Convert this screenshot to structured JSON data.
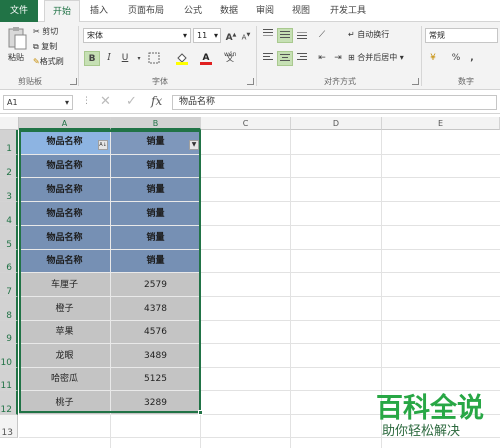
{
  "tabs": [
    "文件",
    "开始",
    "插入",
    "页面布局",
    "公式",
    "数据",
    "审阅",
    "视图",
    "开发工具"
  ],
  "ribbon": {
    "clipboard": {
      "paste": "粘贴",
      "cut": "剪切",
      "copy": "复制",
      "format_painter": "格式刷",
      "label": "剪贴板"
    },
    "font": {
      "name": "宋体",
      "size": "11",
      "bold": "B",
      "italic": "I",
      "underline": "U",
      "label": "字体",
      "grow": "A",
      "shrink": "A",
      "wen": "wén"
    },
    "alignment": {
      "wrap": "自动换行",
      "merge": "合并后居中",
      "label": "对齐方式"
    },
    "number": {
      "format": "常规",
      "percent": "%",
      "comma": ",",
      "label": "数字"
    }
  },
  "name_box": "A1",
  "fx": "fx",
  "formula_value": "物品名称",
  "columns": [
    "A",
    "B",
    "C",
    "D",
    "E"
  ],
  "rows": [
    "1",
    "2",
    "3",
    "4",
    "5",
    "6",
    "7",
    "8",
    "9",
    "10",
    "11",
    "12",
    "13"
  ],
  "header_row": {
    "a": "物品名称",
    "b": "销量"
  },
  "filter_icon_a": "A↓",
  "filter_icon_b": "▼",
  "repeat_rows": [
    {
      "a": "物品名称",
      "b": "销量"
    },
    {
      "a": "物品名称",
      "b": "销量"
    },
    {
      "a": "物品名称",
      "b": "销量"
    },
    {
      "a": "物品名称",
      "b": "销量"
    },
    {
      "a": "物品名称",
      "b": "销量"
    }
  ],
  "data_rows": [
    {
      "a": "车厘子",
      "b": "2579"
    },
    {
      "a": "橙子",
      "b": "4378"
    },
    {
      "a": "苹果",
      "b": "4576"
    },
    {
      "a": "龙眼",
      "b": "3489"
    },
    {
      "a": "哈密瓜",
      "b": "5125"
    },
    {
      "a": "桃子",
      "b": "3289"
    }
  ],
  "watermark": {
    "line1": "百科全说",
    "line2": "助你轻松解决"
  },
  "colors": {
    "accent": "#217346",
    "header_fill": "#8db4e2",
    "repeat_fill": "#7690b4",
    "data_fill": "#c4c4c4"
  }
}
